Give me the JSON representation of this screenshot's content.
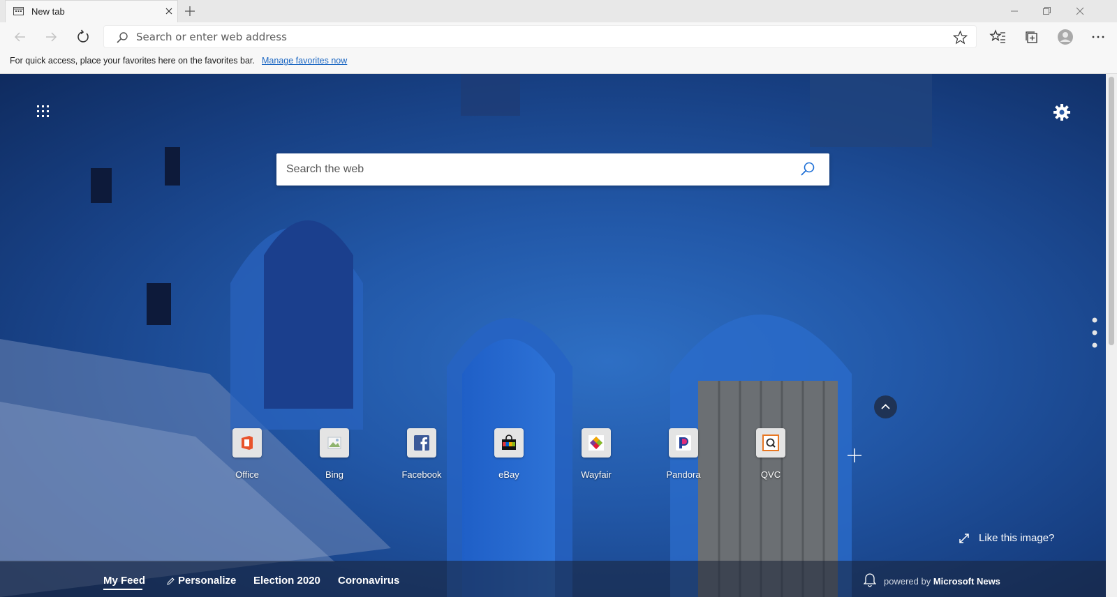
{
  "tab": {
    "title": "New tab"
  },
  "address_bar": {
    "placeholder": "Search or enter web address"
  },
  "favorites_bar": {
    "message": "For quick access, place your favorites here on the favorites bar.",
    "link": "Manage favorites now"
  },
  "web_search": {
    "placeholder": "Search the web"
  },
  "quick_links": [
    {
      "label": "Office",
      "icon": "office-icon",
      "color": "#e8532b"
    },
    {
      "label": "Bing",
      "icon": "bing-icon",
      "color": "#bcc8d4"
    },
    {
      "label": "Facebook",
      "icon": "facebook-icon",
      "color": "#3b5998"
    },
    {
      "label": "eBay",
      "icon": "ebay-icon",
      "color": "#111111"
    },
    {
      "label": "Wayfair",
      "icon": "wayfair-icon",
      "color": "#7b3a96"
    },
    {
      "label": "Pandora",
      "icon": "pandora-icon",
      "color": "#224099"
    },
    {
      "label": "QVC",
      "icon": "qvc-icon",
      "color": "#e87722"
    }
  ],
  "like_image": "Like this image?",
  "feed": {
    "items": [
      "My Feed",
      "Personalize",
      "Election 2020",
      "Coronavirus"
    ],
    "powered_prefix": "powered by",
    "powered_brand": "Microsoft News"
  }
}
